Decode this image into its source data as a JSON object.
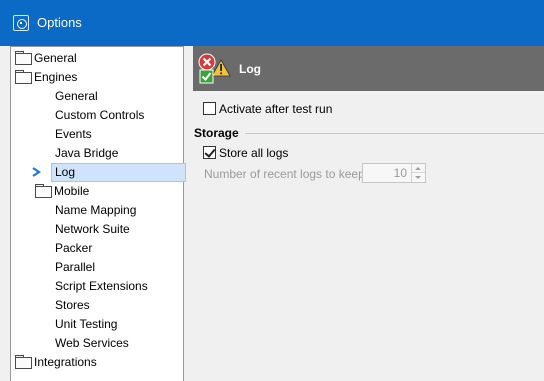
{
  "window": {
    "title": "Options"
  },
  "tree": {
    "items": [
      {
        "label": "General",
        "level": 0,
        "folder": true
      },
      {
        "label": "Engines",
        "level": 0,
        "folder": true
      },
      {
        "label": "General",
        "level": 1,
        "folder": false
      },
      {
        "label": "Custom Controls",
        "level": 1,
        "folder": false
      },
      {
        "label": "Events",
        "level": 1,
        "folder": false
      },
      {
        "label": "Java Bridge",
        "level": 1,
        "folder": false
      },
      {
        "label": "Log",
        "level": 1,
        "folder": false,
        "selected": true
      },
      {
        "label": "Mobile",
        "level": 1,
        "folder": true
      },
      {
        "label": "Name Mapping",
        "level": 1,
        "folder": false
      },
      {
        "label": "Network Suite",
        "level": 1,
        "folder": false
      },
      {
        "label": "Packer",
        "level": 1,
        "folder": false
      },
      {
        "label": "Parallel",
        "level": 1,
        "folder": false
      },
      {
        "label": "Script Extensions",
        "level": 1,
        "folder": false
      },
      {
        "label": "Stores",
        "level": 1,
        "folder": false
      },
      {
        "label": "Unit Testing",
        "level": 1,
        "folder": false
      },
      {
        "label": "Web Services",
        "level": 1,
        "folder": false
      },
      {
        "label": "Integrations",
        "level": 0,
        "folder": true
      }
    ]
  },
  "panel": {
    "title": "Log",
    "activate_label": "Activate after test run",
    "activate_checked": false,
    "storage_label": "Storage",
    "store_all_label": "Store all logs",
    "store_all_checked": true,
    "recent_logs_label": "Number of recent logs to keep:",
    "recent_logs_value": "10"
  },
  "colors": {
    "titlebar": "#0b6ac6",
    "header_bar": "#6b6b6b",
    "selection": "#cfe4fb"
  }
}
